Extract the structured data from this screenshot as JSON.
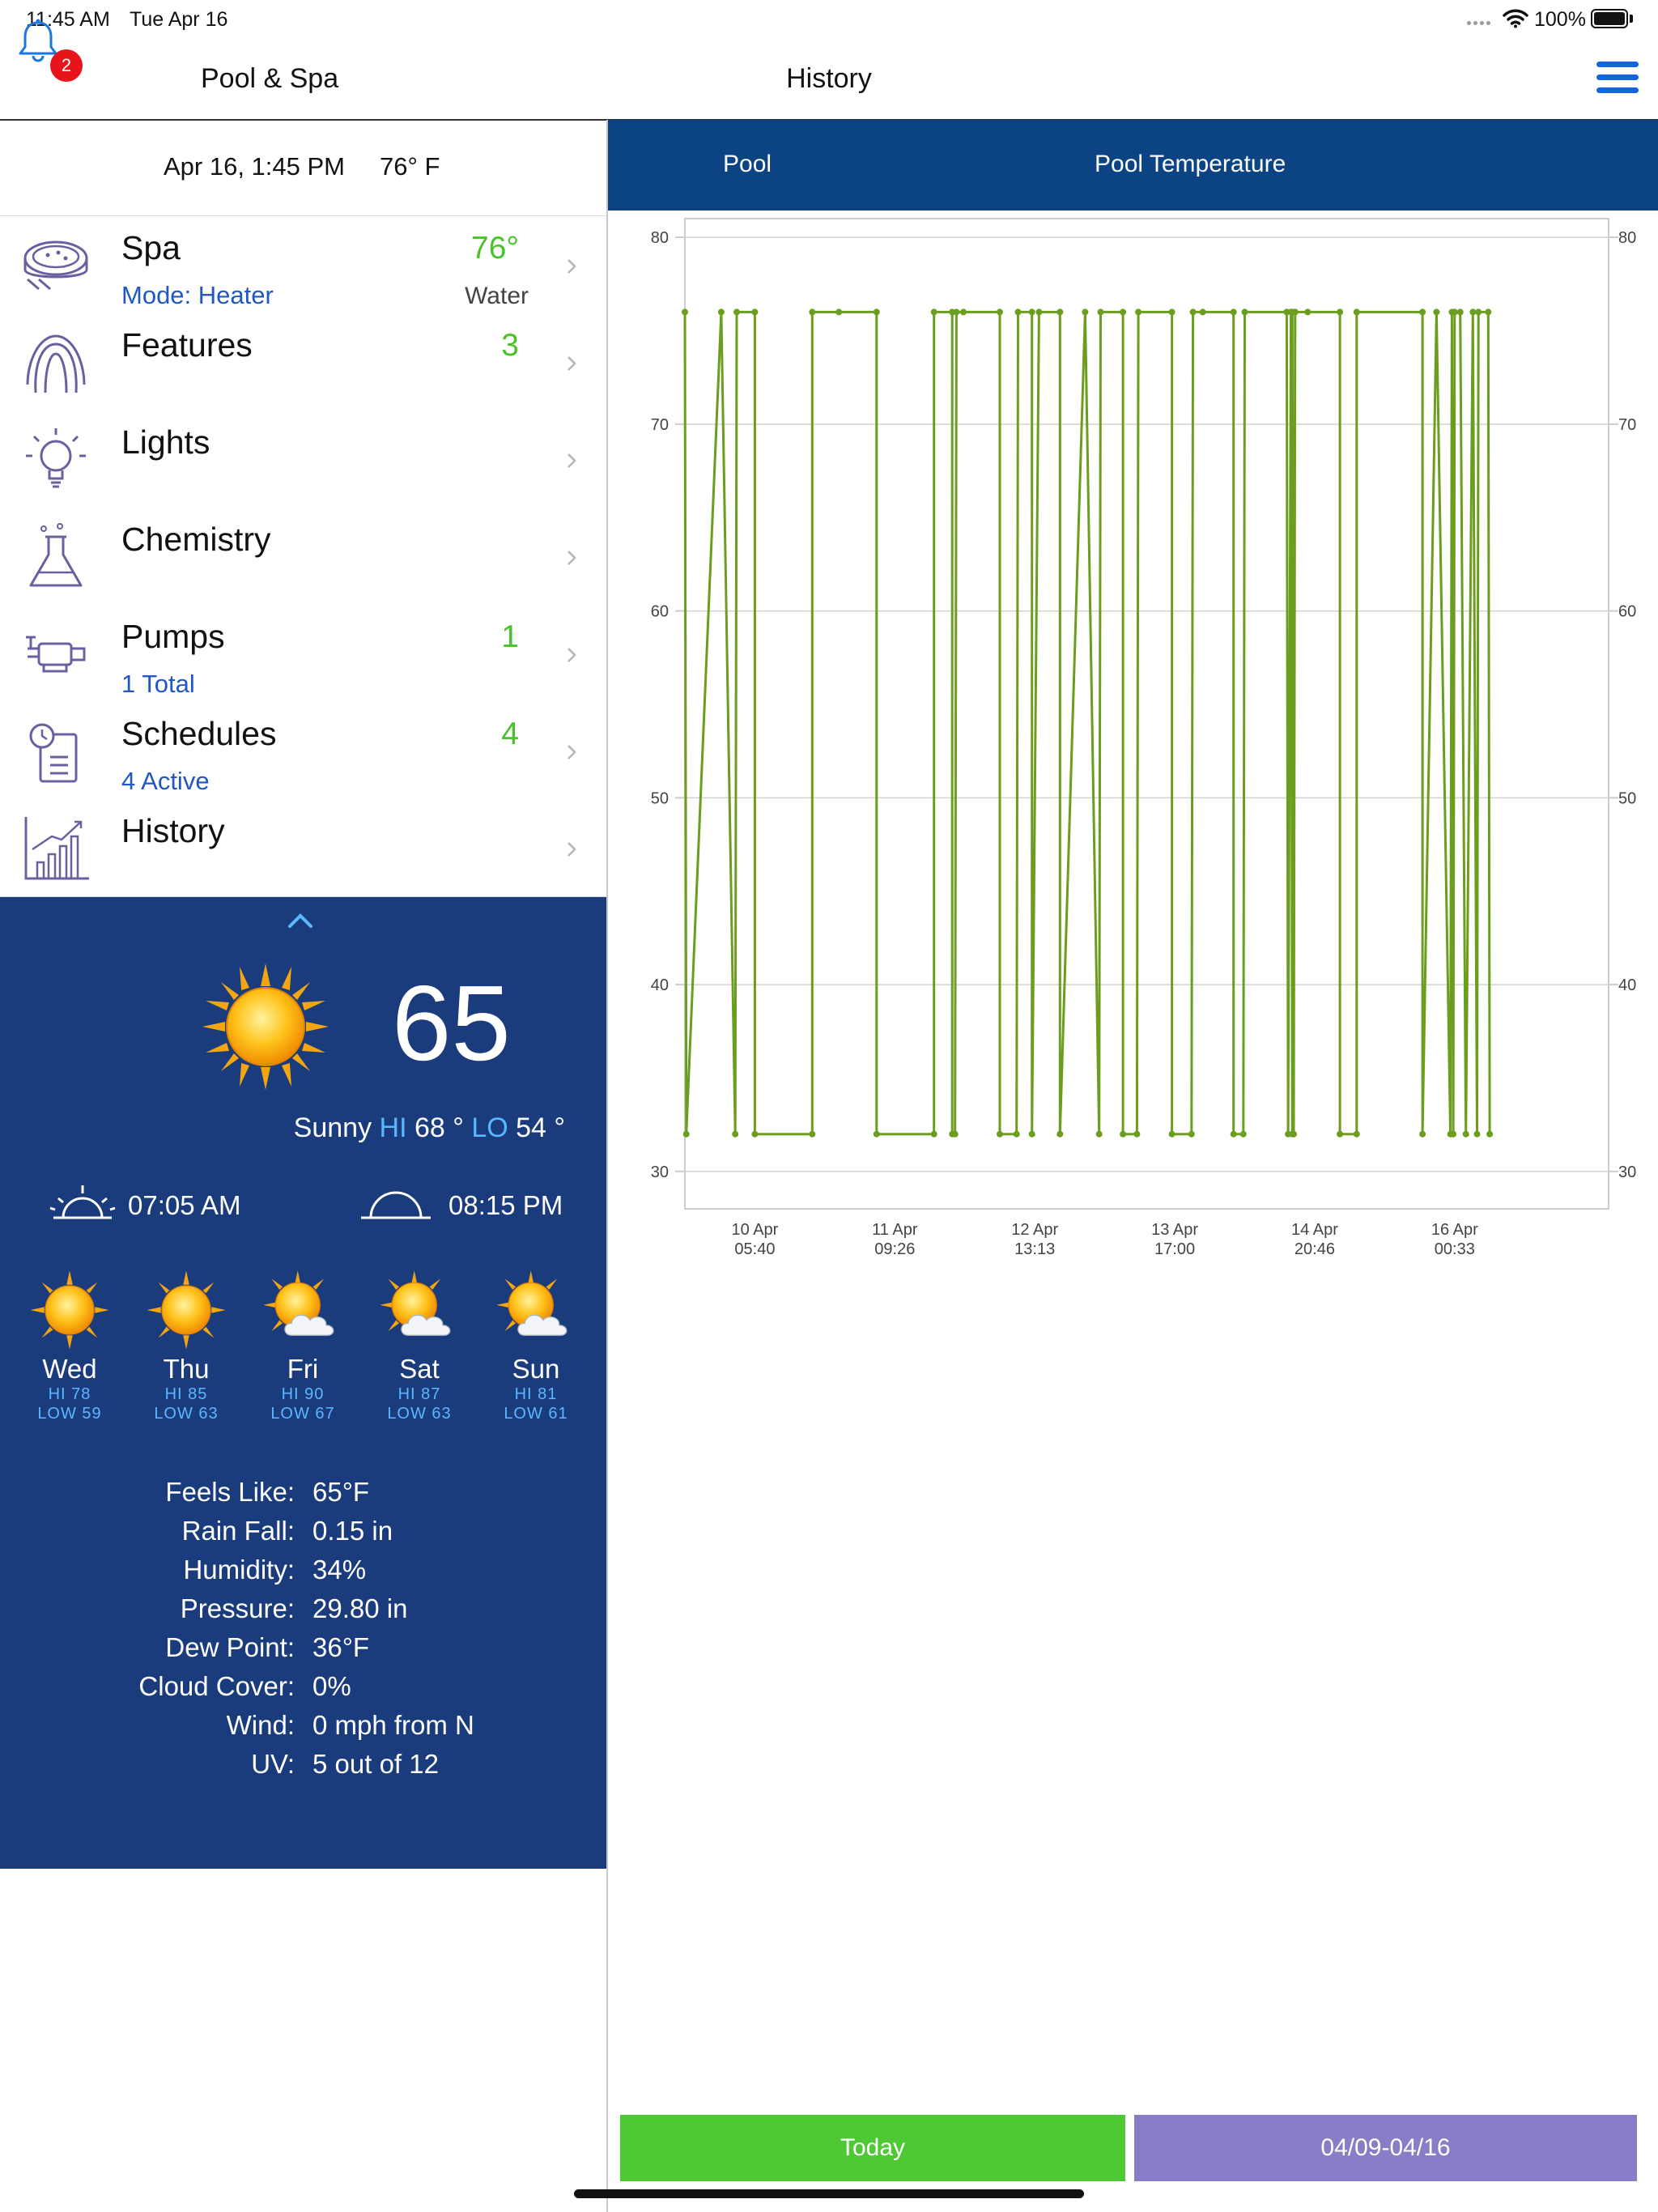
{
  "status_bar": {
    "time": "11:45 AM",
    "date": "Tue Apr 16",
    "battery": "100%"
  },
  "nav": {
    "left_title": "Pool & Spa",
    "center_title": "History",
    "notification_count": "2"
  },
  "summary": {
    "datetime": "Apr 16, 1:45 PM",
    "temperature": "76° F"
  },
  "menu": [
    {
      "label": "Spa",
      "sub": "Mode: Heater",
      "count": "76°",
      "sub2": "Water",
      "icon": "spa-icon"
    },
    {
      "label": "Features",
      "sub": "",
      "count": "3",
      "sub2": "",
      "icon": "fountain-icon"
    },
    {
      "label": "Lights",
      "sub": "",
      "count": "",
      "sub2": "",
      "icon": "lightbulb-icon"
    },
    {
      "label": "Chemistry",
      "sub": "",
      "count": "",
      "sub2": "",
      "icon": "flask-icon"
    },
    {
      "label": "Pumps",
      "sub": "1 Total",
      "count": "1",
      "sub2": "",
      "icon": "pump-icon"
    },
    {
      "label": "Schedules",
      "sub": "4 Active",
      "count": "4",
      "sub2": "",
      "icon": "schedule-icon"
    },
    {
      "label": "History",
      "sub": "",
      "count": "",
      "sub2": "",
      "icon": "history-chart-icon"
    }
  ],
  "weather": {
    "current_temp": "65",
    "condition": "Sunny",
    "hi_label": "HI",
    "hi": "68 °",
    "lo_label": "LO",
    "lo": "54 °",
    "sunrise": "07:05 AM",
    "sunset": "08:15 PM",
    "forecast": [
      {
        "day": "Wed",
        "hi": "HI 78",
        "lo": "LOW 59",
        "icon": "sunny-icon"
      },
      {
        "day": "Thu",
        "hi": "HI 85",
        "lo": "LOW 63",
        "icon": "sunny-icon"
      },
      {
        "day": "Fri",
        "hi": "HI 90",
        "lo": "LOW 67",
        "icon": "partly-cloudy-icon"
      },
      {
        "day": "Sat",
        "hi": "HI 87",
        "lo": "LOW 63",
        "icon": "partly-cloudy-icon"
      },
      {
        "day": "Sun",
        "hi": "HI 81",
        "lo": "LOW 61",
        "icon": "partly-cloudy-icon"
      }
    ],
    "details": [
      {
        "key": "Feels Like:",
        "value": "65°F"
      },
      {
        "key": "Rain Fall:",
        "value": "0.15 in"
      },
      {
        "key": "Humidity:",
        "value": "34%"
      },
      {
        "key": "Pressure:",
        "value": "29.80 in"
      },
      {
        "key": "Dew Point:",
        "value": "36°F"
      },
      {
        "key": "Cloud Cover:",
        "value": "0%"
      },
      {
        "key": "Wind:",
        "value": "0 mph from N"
      },
      {
        "key": "UV:",
        "value": "5 out of 12"
      }
    ]
  },
  "history": {
    "header_left": "Pool",
    "header_title": "Pool Temperature",
    "today_button": "Today",
    "range_button": "04/09-04/16"
  },
  "colors": {
    "series": "#6b9e1f",
    "nav_header": "#0b4383",
    "weather_bg": "#1a3b7c",
    "today": "#4ec935",
    "range": "#8a7cc6",
    "count": "#4ac22a",
    "accent_blue": "#1466d8"
  },
  "chart_data": {
    "type": "line",
    "title": "",
    "xlabel": "",
    "ylabel": "",
    "ylim": [
      28,
      81
    ],
    "yticks": [
      30,
      40,
      50,
      60,
      70,
      80
    ],
    "xlim": [
      0,
      6.6
    ],
    "xticks": [
      {
        "x": 0.5,
        "label1": "10 Apr",
        "label2": "05:40"
      },
      {
        "x": 1.5,
        "label1": "11 Apr",
        "label2": "09:26"
      },
      {
        "x": 2.5,
        "label1": "12 Apr",
        "label2": "13:13"
      },
      {
        "x": 3.5,
        "label1": "13 Apr",
        "label2": "17:00"
      },
      {
        "x": 4.5,
        "label1": "14 Apr",
        "label2": "20:46"
      },
      {
        "x": 5.5,
        "label1": "16 Apr",
        "label2": "00:33"
      }
    ],
    "series": [
      {
        "color": "#6b9e1f",
        "points": [
          [
            0.0,
            76
          ],
          [
            0.01,
            32
          ],
          [
            0.26,
            76
          ],
          [
            0.36,
            32
          ],
          [
            0.37,
            76
          ],
          [
            0.5,
            76
          ],
          [
            0.5,
            32
          ],
          [
            0.91,
            32
          ],
          [
            0.91,
            76
          ],
          [
            1.1,
            76
          ],
          [
            1.37,
            76
          ],
          [
            1.37,
            32
          ],
          [
            1.78,
            32
          ],
          [
            1.78,
            76
          ],
          [
            1.91,
            76
          ],
          [
            1.91,
            32
          ],
          [
            1.93,
            32
          ],
          [
            1.94,
            76
          ],
          [
            1.99,
            76
          ],
          [
            2.25,
            76
          ],
          [
            2.25,
            32
          ],
          [
            2.37,
            32
          ],
          [
            2.38,
            76
          ],
          [
            2.48,
            76
          ],
          [
            2.48,
            32
          ],
          [
            2.53,
            76
          ],
          [
            2.68,
            76
          ],
          [
            2.68,
            32
          ],
          [
            2.86,
            76
          ],
          [
            2.96,
            32
          ],
          [
            2.97,
            76
          ],
          [
            3.13,
            76
          ],
          [
            3.13,
            32
          ],
          [
            3.23,
            32
          ],
          [
            3.24,
            76
          ],
          [
            3.48,
            76
          ],
          [
            3.48,
            32
          ],
          [
            3.62,
            32
          ],
          [
            3.63,
            76
          ],
          [
            3.7,
            76
          ],
          [
            3.92,
            76
          ],
          [
            3.92,
            32
          ],
          [
            3.99,
            32
          ],
          [
            4.0,
            76
          ],
          [
            4.3,
            76
          ],
          [
            4.31,
            32
          ],
          [
            4.33,
            76
          ],
          [
            4.34,
            32
          ],
          [
            4.34,
            76
          ],
          [
            4.35,
            32
          ],
          [
            4.36,
            76
          ],
          [
            4.45,
            76
          ],
          [
            4.68,
            76
          ],
          [
            4.68,
            32
          ],
          [
            4.8,
            32
          ],
          [
            4.8,
            76
          ],
          [
            5.27,
            76
          ],
          [
            5.27,
            32
          ],
          [
            5.37,
            76
          ],
          [
            5.47,
            32
          ],
          [
            5.48,
            76
          ],
          [
            5.49,
            32
          ],
          [
            5.5,
            76
          ],
          [
            5.54,
            76
          ],
          [
            5.58,
            32
          ],
          [
            5.63,
            76
          ],
          [
            5.66,
            32
          ],
          [
            5.67,
            76
          ],
          [
            5.74,
            76
          ],
          [
            5.75,
            32
          ]
        ]
      }
    ]
  }
}
